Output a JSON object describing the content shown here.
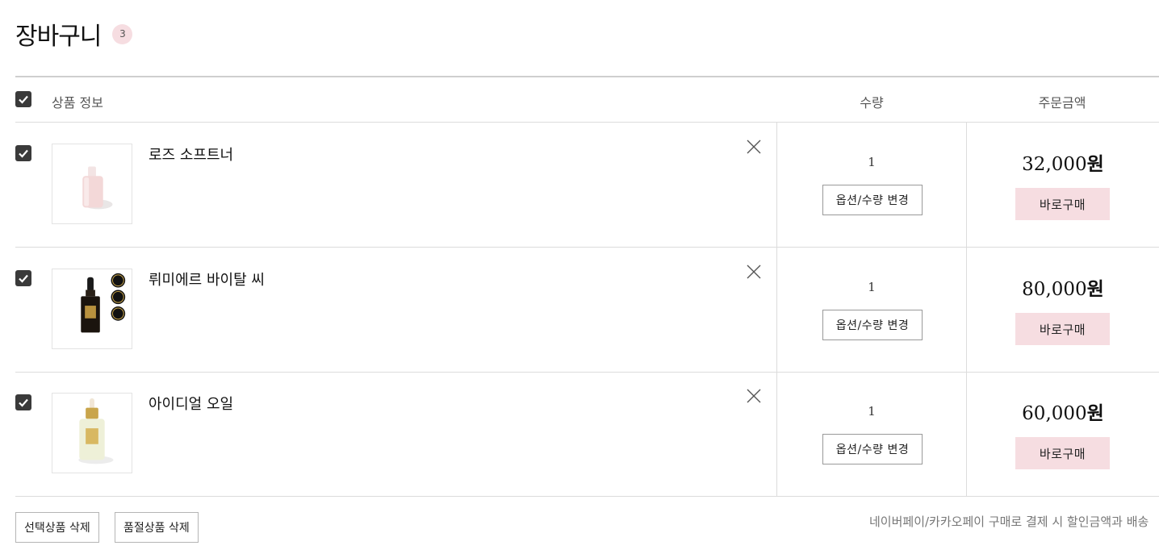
{
  "header": {
    "title": "장바구니",
    "item_count": "3"
  },
  "table_header": {
    "product_info": "상품 정보",
    "quantity": "수량",
    "order_amount": "주문금액"
  },
  "items": [
    {
      "name": "로즈 소프트너",
      "quantity": "1",
      "option_label": "옵션/수량 변경",
      "price_number": "32,000",
      "price_unit": "원",
      "buy_label": "바로구매",
      "checked": true
    },
    {
      "name": "뤼미에르 바이탈 씨",
      "quantity": "1",
      "option_label": "옵션/수량 변경",
      "price_number": "80,000",
      "price_unit": "원",
      "buy_label": "바로구매",
      "checked": true
    },
    {
      "name": "아이디얼 오일",
      "quantity": "1",
      "option_label": "옵션/수량 변경",
      "price_number": "60,000",
      "price_unit": "원",
      "buy_label": "바로구매",
      "checked": true
    }
  ],
  "footer": {
    "delete_selected": "선택상품 삭제",
    "delete_soldout": "품절상품 삭제",
    "notice": "네이버페이/카카오페이 구매로 결제 시 할인금액과 배송"
  },
  "colors": {
    "accent_pink": "#f6dde1",
    "checkbox": "#3a3a3a",
    "border": "#dcdcdc"
  },
  "icons": {
    "checkbox": "checkmark-icon",
    "remove": "close-icon"
  }
}
